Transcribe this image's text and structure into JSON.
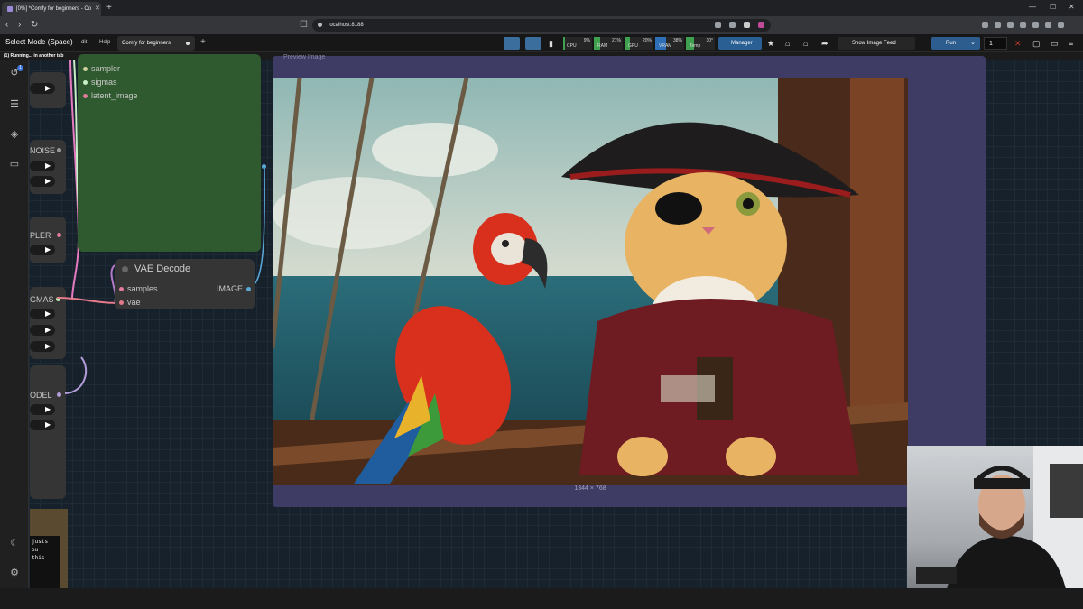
{
  "browser": {
    "tab_title": "[0%] *Comfy for beginners - Co",
    "url": "localhost:8188"
  },
  "menubar": {
    "mode_label": "Select Mode (Space)",
    "edit_label": "dit",
    "help_label": "Help",
    "workflow_tab": "Comfy for beginners",
    "meters": [
      {
        "label": "CPU",
        "pct": "9%"
      },
      {
        "label": "RAM",
        "pct": "21%"
      },
      {
        "label": "GPU",
        "pct": "20%"
      },
      {
        "label": "VRAM",
        "pct": "38%"
      },
      {
        "label": "Temp",
        "pct": "30°"
      }
    ],
    "manager_label": "Manager",
    "image_feed_label": "Show Image Feed",
    "run_label": "Run",
    "batch_count": "1"
  },
  "status": {
    "text": "(1) Running... in another tab"
  },
  "canvas": {
    "green_node_inputs": [
      "sampler",
      "sigmas",
      "latent_image"
    ],
    "vae_decode": {
      "title": "VAE Decode",
      "inputs": [
        "samples",
        "vae"
      ],
      "output": "IMAGE"
    },
    "left_node_labels": {
      "noise": "NOISE",
      "sampler": "PLER",
      "sigmas": "GMAS",
      "model": "ODEL"
    },
    "note_text": "justs\nou\nthis",
    "preview": {
      "title": "Preview Image",
      "dims": "1344 × 768"
    }
  },
  "colors": {
    "accent": "#3b6e9c",
    "canvas_bg": "#17212b",
    "group_green": "#2f5a2f",
    "preview_frame": "#3e3b64"
  }
}
